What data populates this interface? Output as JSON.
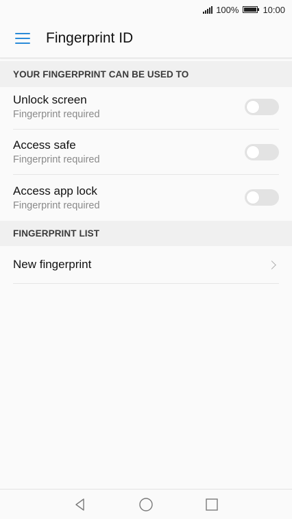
{
  "status_bar": {
    "battery_percent": "100%",
    "battery_level": 1.0,
    "time": "10:00"
  },
  "app_bar": {
    "menu_icon": "hamburger-menu-icon",
    "title": "Fingerprint ID",
    "accent_color": "#2a8bd8"
  },
  "sections": [
    {
      "header": "YOUR FINGERPRINT CAN BE USED TO",
      "items": [
        {
          "title": "Unlock screen",
          "subtitle": "Fingerprint required",
          "enabled": false
        },
        {
          "title": "Access safe",
          "subtitle": "Fingerprint required",
          "enabled": false
        },
        {
          "title": "Access app lock",
          "subtitle": "Fingerprint required",
          "enabled": false
        }
      ]
    },
    {
      "header": "FINGERPRINT LIST",
      "items": [
        {
          "title": "New fingerprint",
          "icon": "chevron-right-icon"
        }
      ]
    }
  ],
  "nav_bar": {
    "back_icon": "back-triangle-icon",
    "home_icon": "home-circle-icon",
    "recents_icon": "recents-square-icon"
  }
}
